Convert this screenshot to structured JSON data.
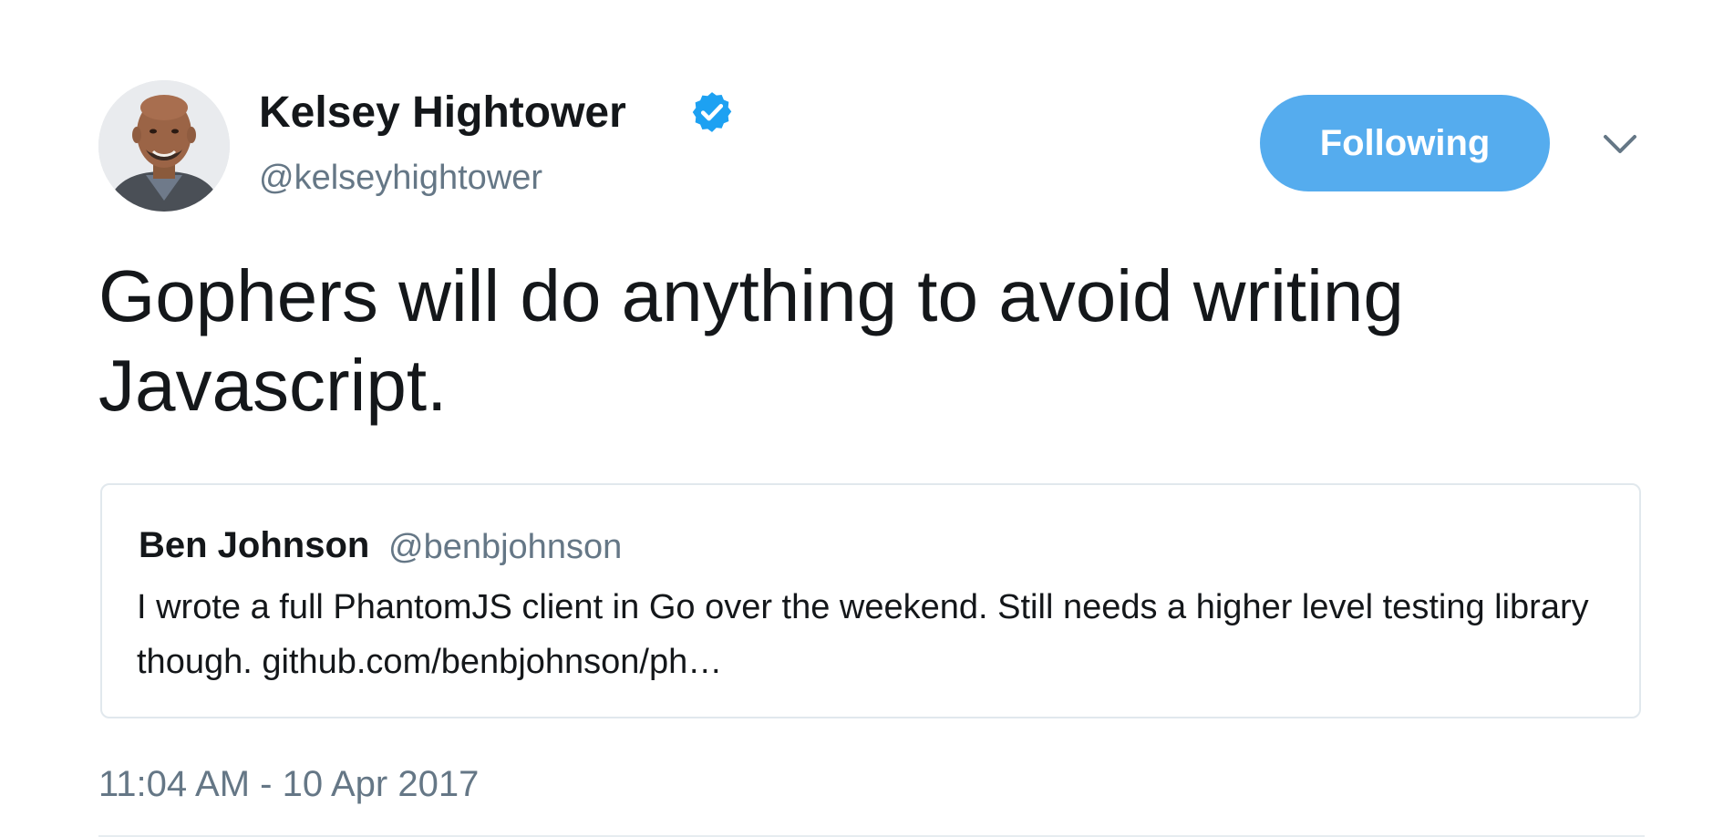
{
  "tweet": {
    "author": {
      "name": "Kelsey Hightower",
      "handle": "@kelseyhightower",
      "verified": true,
      "verified_icon": "verified-badge-icon",
      "avatar": "profile-photo"
    },
    "follow_button": {
      "label": "Following",
      "color": "#55acee"
    },
    "menu_icon": "chevron-down-icon",
    "text": "Gophers will do anything to avoid writing Javascript.",
    "quoted_tweet": {
      "author_name": "Ben Johnson",
      "author_handle": "@benbjohnson",
      "text": "I wrote a full PhantomJS client in Go over the weekend. Still needs a higher level testing library though. github.com/benbjohnson/ph…"
    },
    "timestamp": "11:04 AM - 10 Apr 2017"
  },
  "colors": {
    "accent": "#55acee",
    "verified": "#1da1f2",
    "text_primary": "#14171a",
    "text_secondary": "#657786",
    "border": "#e1e8ed"
  }
}
